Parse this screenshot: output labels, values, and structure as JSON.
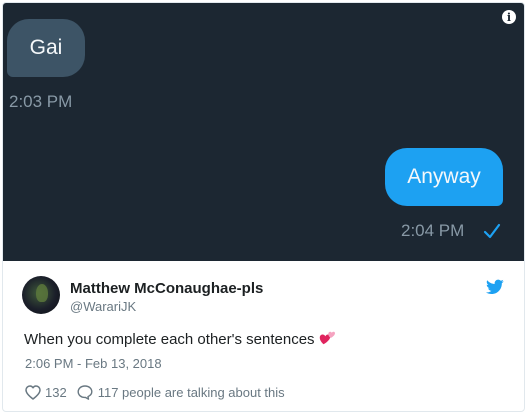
{
  "media": {
    "incoming_message": "Gai",
    "incoming_time": "2:03 PM",
    "outgoing_message": "Anyway",
    "outgoing_time": "2:04 PM",
    "info_symbol": "i",
    "colors": {
      "background": "#1c2732",
      "incoming_bubble": "#3d5466",
      "outgoing_bubble": "#1da1f2",
      "timestamp": "#8899a6"
    }
  },
  "author": {
    "display_name": "Matthew McConaughae-pls",
    "handle": "@WarariJK"
  },
  "tweet": {
    "text": "When you complete each other's sentences",
    "emoji_icon": "two-hearts-icon",
    "date": "2:06 PM - Feb 13, 2018"
  },
  "actions": {
    "like_count": "132",
    "talking_text": "117 people are talking about this"
  },
  "brand": {
    "icon": "twitter-bird-icon",
    "color": "#1da1f2"
  }
}
